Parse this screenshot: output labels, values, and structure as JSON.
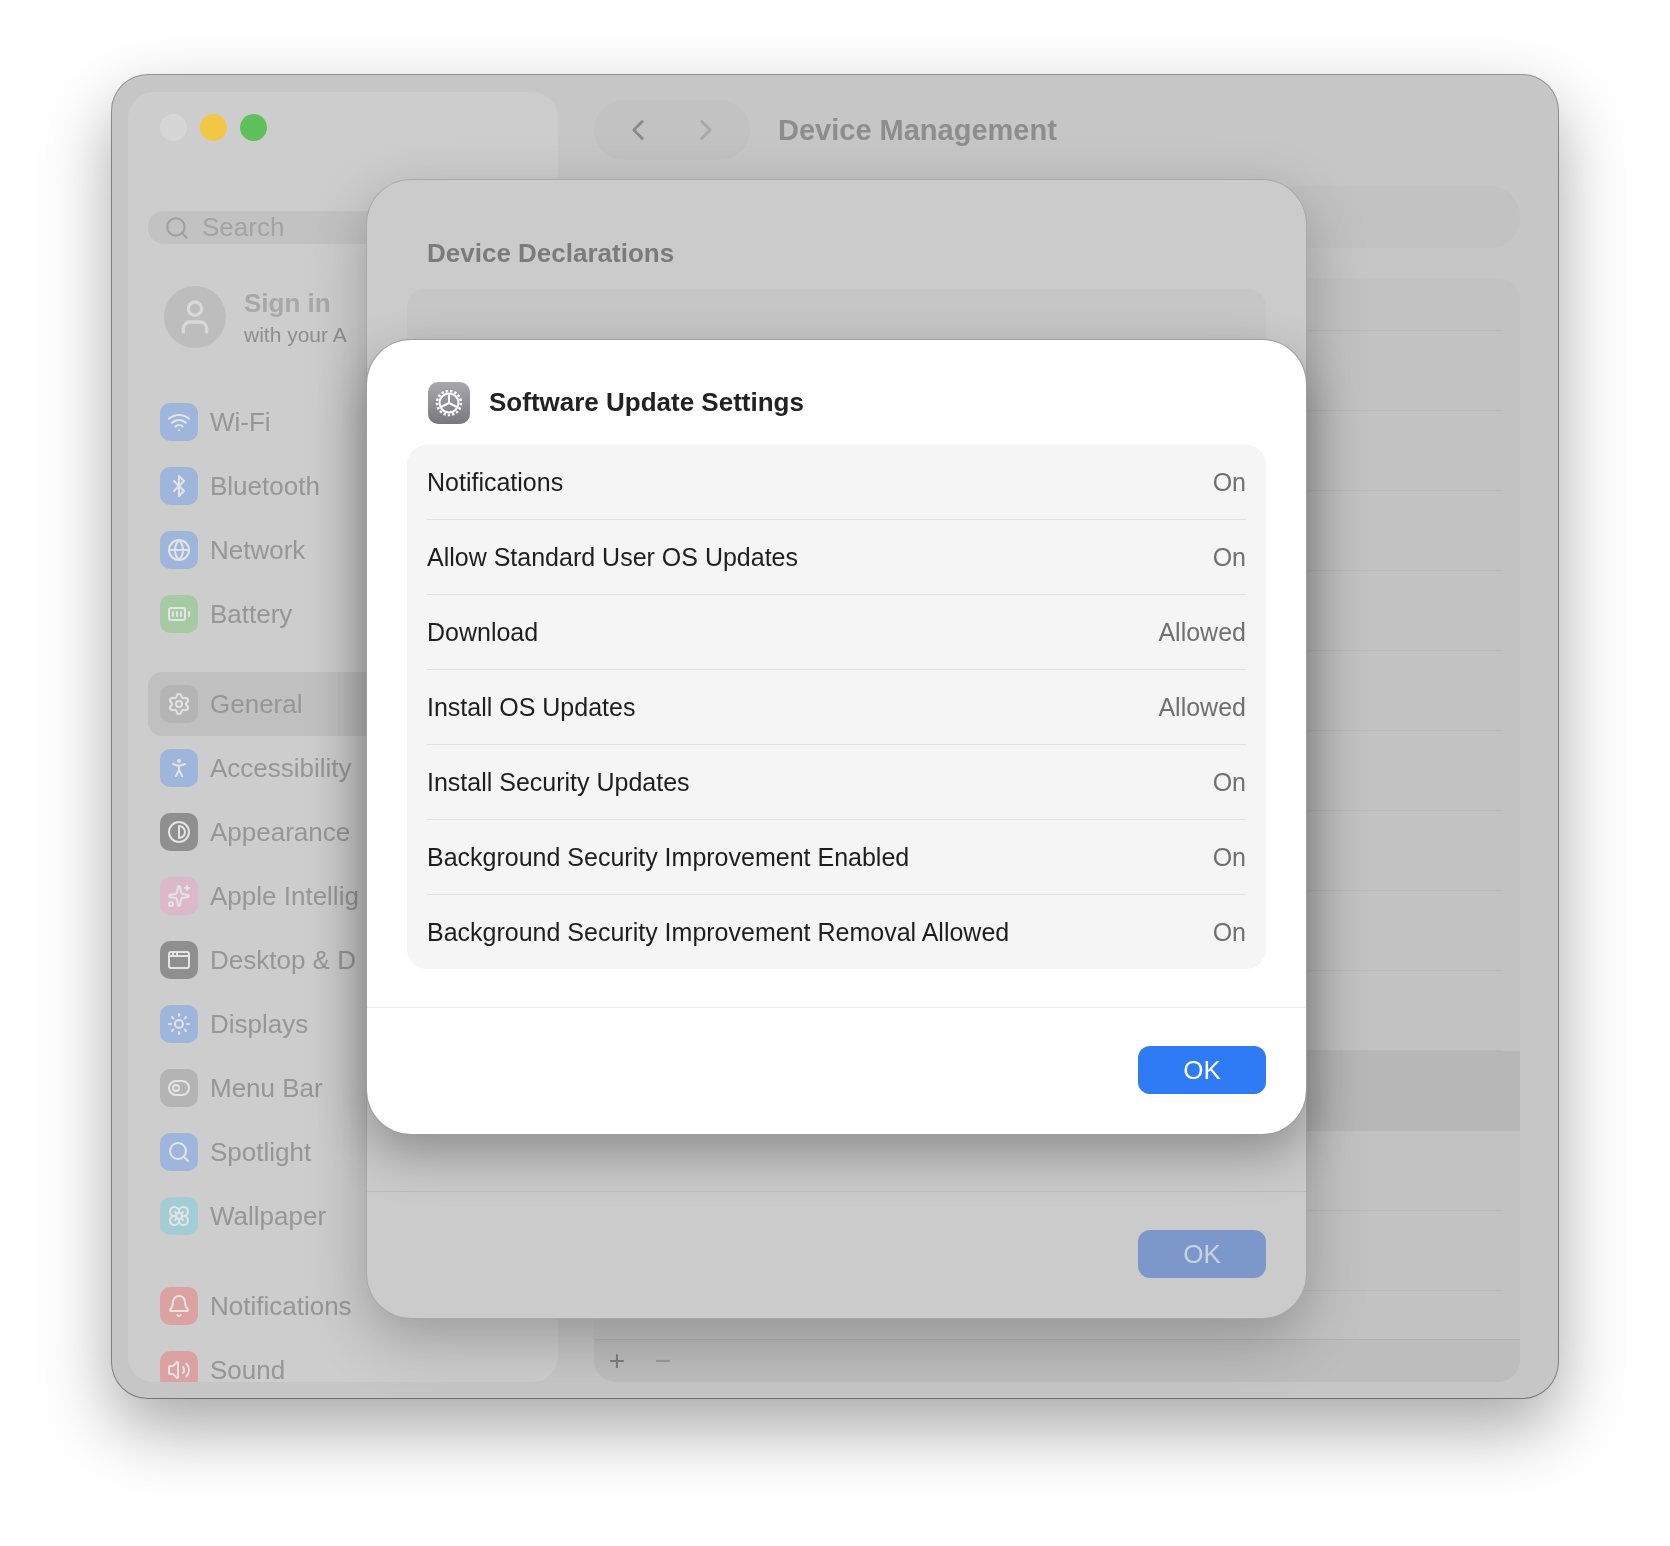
{
  "window": {
    "title": "Device Management"
  },
  "sidebar": {
    "search": {
      "placeholder": "Search"
    },
    "account": {
      "title": "Sign in",
      "subtitle": "with your A"
    },
    "groups": [
      [
        {
          "label": "Wi-Fi",
          "selected": false,
          "color": "#9fb6dc"
        },
        {
          "label": "Bluetooth",
          "selected": false,
          "color": "#9fb6dc"
        },
        {
          "label": "Network",
          "selected": false,
          "color": "#9fb6dc"
        },
        {
          "label": "Battery",
          "selected": false,
          "color": "#a6cba4"
        }
      ],
      [
        {
          "label": "General",
          "selected": true,
          "color": "#b4b4b4"
        },
        {
          "label": "Accessibility",
          "selected": false,
          "color": "#9fb6dc"
        },
        {
          "label": "Appearance",
          "selected": false,
          "color": "#8f8f8f"
        },
        {
          "label": "Apple Intellig",
          "selected": false,
          "color": "#dcb9c9"
        },
        {
          "label": "Desktop & D",
          "selected": false,
          "color": "#8f8f8f"
        },
        {
          "label": "Displays",
          "selected": false,
          "color": "#9fb6dc"
        },
        {
          "label": "Menu Bar",
          "selected": false,
          "color": "#b4b4b4"
        },
        {
          "label": "Spotlight",
          "selected": false,
          "color": "#9fb6dc"
        },
        {
          "label": "Wallpaper",
          "selected": false,
          "color": "#a2cdd6"
        }
      ],
      [
        {
          "label": "Notifications",
          "selected": false,
          "color": "#dca2a2"
        },
        {
          "label": "Sound",
          "selected": false,
          "color": "#dca2a2"
        }
      ]
    ]
  },
  "list_toolbar": {
    "add": "+",
    "remove": "−"
  },
  "back_sheet": {
    "title": "Device Declarations",
    "ok_button": "OK"
  },
  "dialog": {
    "title": "Software Update Settings",
    "ok_button": "OK",
    "rows": [
      {
        "label": "Notifications",
        "value": "On"
      },
      {
        "label": "Allow Standard User OS Updates",
        "value": "On"
      },
      {
        "label": "Download",
        "value": "Allowed"
      },
      {
        "label": "Install OS Updates",
        "value": "Allowed"
      },
      {
        "label": "Install Security Updates",
        "value": "On"
      },
      {
        "label": "Background Security Improvement Enabled",
        "value": "On"
      },
      {
        "label": "Background Security Improvement Removal Allowed",
        "value": "On"
      }
    ]
  }
}
